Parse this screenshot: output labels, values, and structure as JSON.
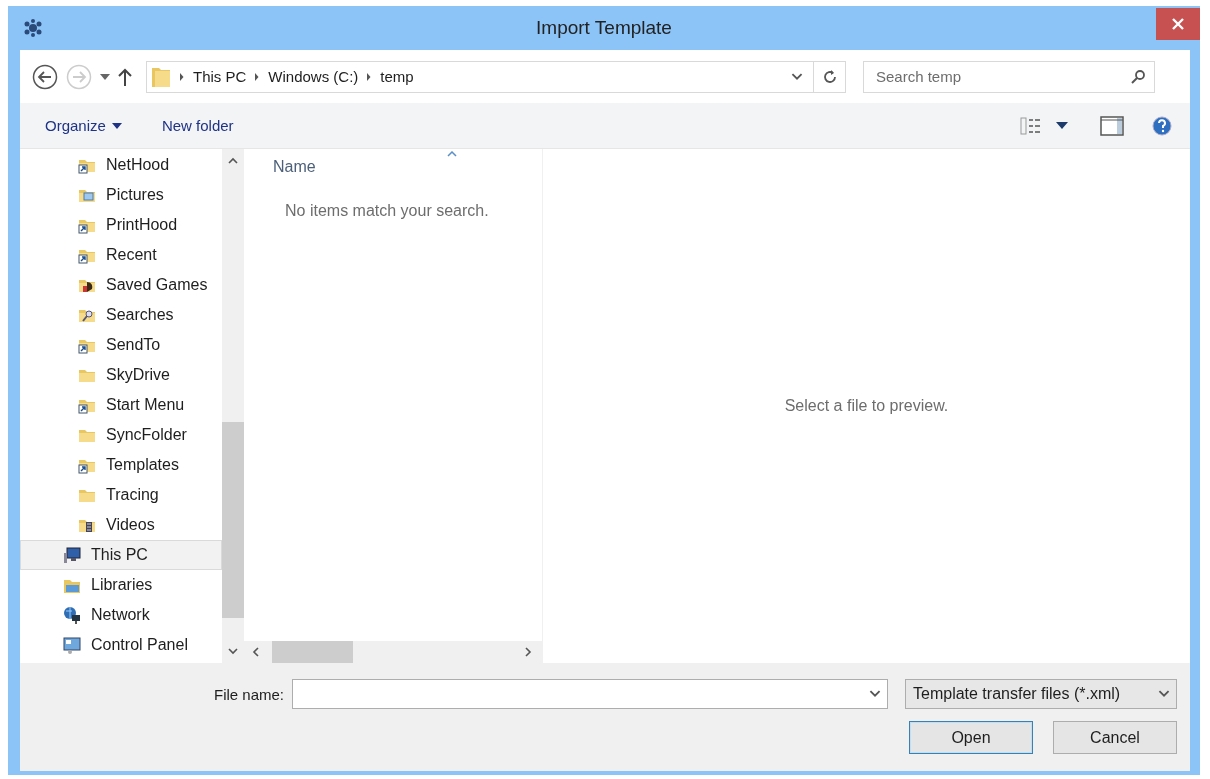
{
  "window": {
    "title": "Import Template"
  },
  "address_bar": {
    "crumbs": [
      "This PC",
      "Windows (C:)",
      "temp"
    ]
  },
  "search": {
    "placeholder": "Search temp"
  },
  "command_bar": {
    "organize": "Organize",
    "new_folder": "New folder"
  },
  "nav_tree": [
    {
      "children": [
        {
          "label": "NetHood",
          "kind": "shortcut",
          "selected": false
        },
        {
          "label": "Pictures",
          "kind": "pictures",
          "selected": false
        },
        {
          "label": "PrintHood",
          "kind": "shortcut",
          "selected": false
        },
        {
          "label": "Recent",
          "kind": "shortcut",
          "selected": false
        },
        {
          "label": "Saved Games",
          "kind": "games",
          "selected": false
        },
        {
          "label": "Searches",
          "kind": "searches",
          "selected": false
        },
        {
          "label": "SendTo",
          "kind": "shortcut",
          "selected": false
        },
        {
          "label": "SkyDrive",
          "kind": "folder",
          "selected": false
        },
        {
          "label": "Start Menu",
          "kind": "shortcut",
          "selected": false
        },
        {
          "label": "SyncFolder",
          "kind": "folder",
          "selected": false
        },
        {
          "label": "Templates",
          "kind": "shortcut",
          "selected": false
        },
        {
          "label": "Tracing",
          "kind": "folder",
          "selected": false
        },
        {
          "label": "Videos",
          "kind": "videos",
          "selected": false
        }
      ]
    },
    {
      "label": "This PC",
      "kind": "pc",
      "selected": true
    },
    {
      "label": "Libraries",
      "kind": "libraries",
      "selected": false
    },
    {
      "label": "Network",
      "kind": "network",
      "selected": false
    },
    {
      "label": "Control Panel",
      "kind": "control-panel",
      "selected": false
    }
  ],
  "file_list": {
    "column": "Name",
    "empty_message": "No items match your search."
  },
  "preview": {
    "message": "Select a file to preview."
  },
  "footer": {
    "file_name_label": "File name:",
    "file_type": "Template transfer files (*.xml)",
    "buttons": [
      {
        "label": "Open",
        "kind": "default"
      },
      {
        "label": "Cancel",
        "kind": "normal"
      }
    ]
  }
}
